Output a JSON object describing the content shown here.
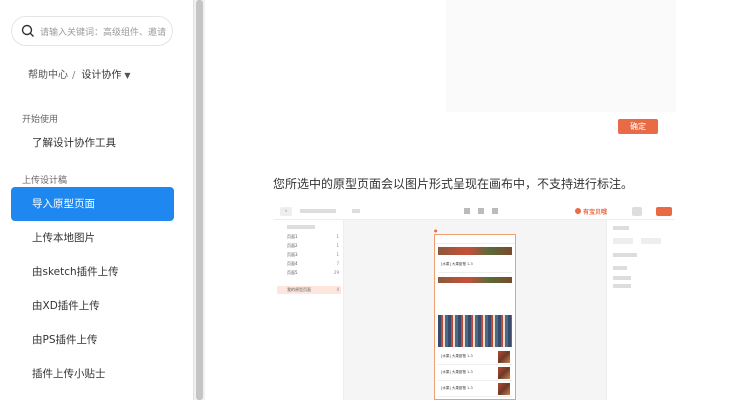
{
  "search": {
    "placeholder": "请输入关键词：高级组件、邀请"
  },
  "breadcrumb": {
    "root": "帮助中心",
    "separator": "/",
    "current": "设计协作"
  },
  "sidebar": {
    "sections": [
      {
        "title": "开始使用",
        "items": [
          {
            "label": "了解设计协作工具"
          }
        ]
      },
      {
        "title": "上传设计稿",
        "items": [
          {
            "label": "导入原型页面",
            "active": true
          },
          {
            "label": "上传本地图片"
          },
          {
            "label": "由sketch插件上传"
          },
          {
            "label": "由XD插件上传"
          },
          {
            "label": "由PS插件上传"
          },
          {
            "label": "插件上传小贴士"
          }
        ]
      }
    ]
  },
  "main": {
    "confirm_button": "确定",
    "paragraph": "您所选中的原型页面会以图片形式呈现在画布中，不支持进行标注。"
  },
  "colors": {
    "accent": "#1e87f0",
    "brand": "#e96b45"
  },
  "screenshot": {
    "logo_text": "有宝贝哦",
    "left_list": [
      {
        "label": "页面1",
        "count": "1"
      },
      {
        "label": "页面2",
        "count": "1"
      },
      {
        "label": "页面3",
        "count": "1"
      },
      {
        "label": "页面4",
        "count": "7"
      },
      {
        "label": "页面5",
        "count": "29"
      },
      {
        "label": "我的原型页面",
        "count": "4"
      }
    ],
    "phone_cards": [
      {
        "text": "[水果] 大果甜橙 1-3"
      },
      {
        "text": "[水果] 大果甜橙 1-3"
      },
      {
        "text": "[水果] 大果甜橙 1-3"
      },
      {
        "text": "[水果] 大果甜橙 1-3"
      },
      {
        "text": "[水果] 大果甜橙 1-3"
      }
    ]
  }
}
